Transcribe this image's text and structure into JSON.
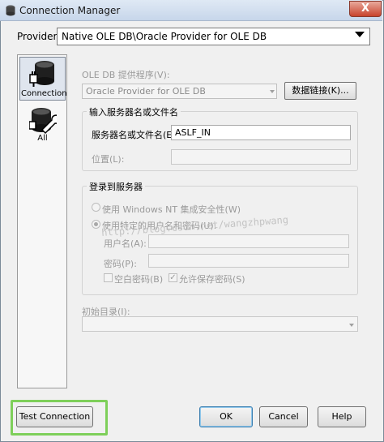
{
  "window": {
    "title": "Connection Manager",
    "close_glyph": "X"
  },
  "provider": {
    "label": "Provider:",
    "value": "Native OLE DB\\Oracle Provider for OLE DB"
  },
  "nav": {
    "items": [
      {
        "label": "Connection",
        "icon": "database-plug-icon",
        "selected": true
      },
      {
        "label": "All",
        "icon": "database-wrench-icon",
        "selected": false
      }
    ]
  },
  "oledb": {
    "label": "OLE DB 提供程序(V):",
    "value": "Oracle Provider for OLE DB",
    "datalinks_label": "数据链接(K)..."
  },
  "server_group": {
    "title": "输入服务器名或文件名",
    "server_label": "服务器名或文件名(E):",
    "server_value": "ASLF_IN",
    "location_label": "位置(L):"
  },
  "login_group": {
    "title": "登录到服务器",
    "windows_nt_label": "使用 Windows NT 集成安全性(W)",
    "specific_user_label": "使用特定的用户名和密码(U):",
    "username_label": "用户名(A):",
    "password_label": "密码(P):",
    "blank_password_label": "空白密码(B)",
    "allow_save_label": "允许保存密码(S)",
    "allow_save_checked": true
  },
  "catalog": {
    "label": "初始目录(I):"
  },
  "watermark": "http://blog.csdn.net/wangzhpwang",
  "buttons": {
    "test": "Test Connection",
    "ok": "OK",
    "cancel": "Cancel",
    "help": "Help"
  },
  "colors": {
    "highlight": "#7ecf5a",
    "close_button": "#c7432c"
  }
}
